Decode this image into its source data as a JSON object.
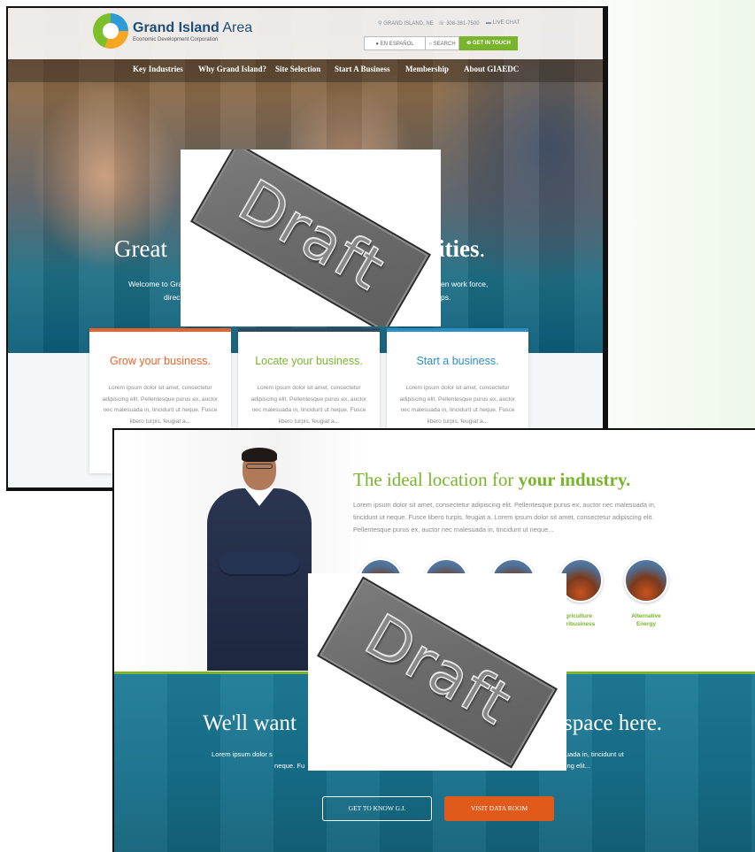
{
  "site1": {
    "logo": {
      "name_bold": "Grand Island",
      "name_light": "Area",
      "subtitle": "Economic Development Corporation"
    },
    "utility": {
      "location": "GRAND ISLAND, NE",
      "phone": "308-381-7500",
      "chat": "LIVE CHAT"
    },
    "buttons": {
      "espanol": "EN ESPAÑOL",
      "search": "SEARCH",
      "contact": "GET IN TOUCH"
    },
    "nav": [
      "Key Industries",
      "Why Grand Island?",
      "Site Selection",
      "Start A Business",
      "Membership",
      "About GIAEDC"
    ],
    "hero": {
      "heading_left": "Great",
      "heading_right_bold": "ities",
      "heading_right_end": ".",
      "line1_left": "Welcome to Gra",
      "line1_right": "en work force,",
      "line2_left": "direc",
      "line2_right": "ps."
    },
    "cards": [
      {
        "title": "Grow your business.",
        "color": "#e8632b",
        "text": "Lorem ipsum dolor sit amet, consectetur adipiscing elit. Pellentesque purus ex, auctor nec malesuada in, tincidunt ut neque. Fusce libero turpis, feugiat a..."
      },
      {
        "title": "Locate your business.",
        "color": "#79b52c",
        "text": "Lorem ipsum dolor sit amet, consectetur adipiscing elit. Pellentesque purus ex, auctor nec malesuada in, tincidunt ut neque. Fusce libero turpis, feugiat a..."
      },
      {
        "title": "Start a business.",
        "color": "#2a8fc9",
        "text": "Lorem ipsum dolor sit amet, consectetur adipiscing elit. Pellentesque purus ex, auctor nec malesuada in, tincidunt ut neque. Fusce libero turpis, feugiat a..."
      }
    ]
  },
  "site2": {
    "industry": {
      "heading_light": "The ideal location for",
      "heading_bold": "your industry.",
      "text": "Lorem ipsum dolor sit amet, consectetur adipiscing elit. Pellentesque purus ex, auctor nec malesuada in, tincidunt ut neque. Fusce libero turpis, feugiat a. Lorem ipsum dolor sit amet, consectetur adipiscing elit. Pellentesque purus ex, auctor nec malesuada in, tincidunt ut neque..."
    },
    "industries": [
      {
        "label_line1": "",
        "label_line2": ""
      },
      {
        "label_line1": "",
        "label_line2": ""
      },
      {
        "label_line1": "",
        "label_line2": ""
      },
      {
        "label_line1": "griculture",
        "label_line2": "gribusiness"
      },
      {
        "label_line1": "Alternative",
        "label_line2": "Energy"
      }
    ],
    "space": {
      "heading_left": "We'll want",
      "heading_right": "space here.",
      "line1_left": "Lorem ipsum dolor s",
      "line1_right": "suada in, tincidunt ut",
      "line2_left": "neque. Fu",
      "line2_right": "cing elit..."
    },
    "buttons": {
      "know": "GET TO KNOW G.I.",
      "data_room": "VISIT DATA ROOM"
    }
  },
  "stamp": {
    "text": "Draft"
  },
  "colors": {
    "orange": "#e8632b",
    "green": "#79b52c",
    "blue": "#2a8fc9",
    "teal": "#17718c",
    "button_orange": "#e05a1c"
  }
}
